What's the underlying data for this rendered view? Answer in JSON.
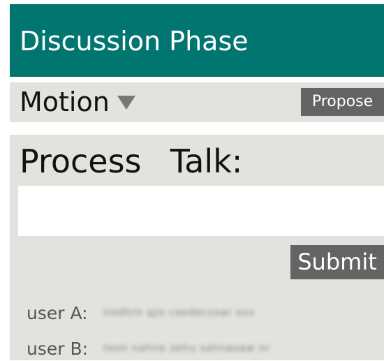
{
  "header": {
    "title": "Discussion Phase"
  },
  "motion_bar": {
    "label": "Motion",
    "dropdown_icon": "triangle-down-icon",
    "propose_label": "Propose"
  },
  "process_talk": {
    "title": "Process  Talk:",
    "input_value": "",
    "submit_label": "Submit",
    "messages": [
      {
        "user": "user A:",
        "text": "iredhrn qzs caedeczoar xxs"
      },
      {
        "user": "user B:",
        "text": "teon nahne zehu sahnaoaw nr"
      }
    ]
  },
  "colors": {
    "header_bg": "#017570",
    "panel_bg": "#e2e2de",
    "button_bg": "#646464"
  }
}
